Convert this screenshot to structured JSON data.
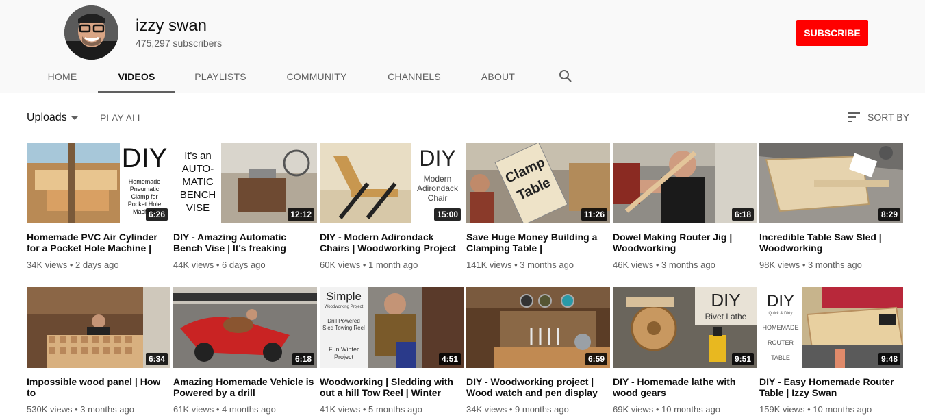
{
  "channel": {
    "name": "izzy swan",
    "subscribers": "475,297 subscribers",
    "subscribe_label": "SUBSCRIBE",
    "accent_color": "#ff0000"
  },
  "tabs": [
    {
      "label": "HOME"
    },
    {
      "label": "VIDEOS",
      "active": true
    },
    {
      "label": "PLAYLISTS"
    },
    {
      "label": "COMMUNITY"
    },
    {
      "label": "CHANNELS"
    },
    {
      "label": "ABOUT"
    }
  ],
  "search_icon": "search-icon",
  "toolbar": {
    "uploads_label": "Uploads",
    "play_all_label": "PLAY ALL",
    "sort_label": "SORT BY"
  },
  "videos": [
    {
      "title": "Homemade PVC Air Cylinder for a Pocket Hole Machine |",
      "views": "34K views",
      "age": "2 days ago",
      "duration": "6:26",
      "thumb_text": [
        "DIY",
        "Homemade",
        "Pneumatic",
        "Clamp for",
        "Pocket Hole",
        "Machine"
      ]
    },
    {
      "title": "DIY - Amazing Automatic Bench Vise | It's freaking",
      "views": "44K views",
      "age": "6 days ago",
      "duration": "12:12",
      "thumb_text": [
        "It's an",
        "AUTO-",
        "MATIC",
        "BENCH",
        "VISE"
      ]
    },
    {
      "title": "DIY - Modern Adirondack Chairs | Woodworking Project",
      "views": "60K views",
      "age": "1 month ago",
      "duration": "15:00",
      "thumb_text": [
        "DIY",
        "Modern",
        "Adirondack",
        "Chair"
      ]
    },
    {
      "title": "Save Huge Money Building a Clamping Table |",
      "views": "141K views",
      "age": "3 months ago",
      "duration": "11:26",
      "thumb_text": [
        "Clamp",
        "Table"
      ]
    },
    {
      "title": "Dowel Making Router Jig | Woodworking",
      "views": "46K views",
      "age": "3 months ago",
      "duration": "6:18"
    },
    {
      "title": "Incredible Table Saw Sled | Woodworking",
      "views": "98K views",
      "age": "3 months ago",
      "duration": "8:29"
    },
    {
      "title": "Impossible wood panel | How to",
      "views": "530K views",
      "age": "3 months ago",
      "duration": "6:34"
    },
    {
      "title": "Amazing Homemade Vehicle is Powered by a drill",
      "views": "61K views",
      "age": "4 months ago",
      "duration": "6:18"
    },
    {
      "title": "Woodworking | Sledding with out a hill Tow Reel | Winter",
      "views": "41K views",
      "age": "5 months ago",
      "duration": "4:51",
      "thumb_text": [
        "Simple",
        "Woodworking Project",
        "Drill Powered",
        "Sled Towing Reel",
        "Fun Winter",
        "Project"
      ]
    },
    {
      "title": "DIY - Woodworking project | Wood watch and pen display",
      "views": "34K views",
      "age": "9 months ago",
      "duration": "6:59"
    },
    {
      "title": "DIY - Homemade lathe with wood gears",
      "views": "69K views",
      "age": "10 months ago",
      "duration": "9:51",
      "thumb_text": [
        "DIY",
        "Rivet Lathe"
      ]
    },
    {
      "title": "DIY - Easy Homemade Router Table | Izzy Swan",
      "views": "159K views",
      "age": "10 months ago",
      "duration": "9:48",
      "thumb_text": [
        "DIY",
        "Quick & Dirty",
        "HOMEMADE",
        "ROUTER",
        "TABLE"
      ]
    }
  ]
}
